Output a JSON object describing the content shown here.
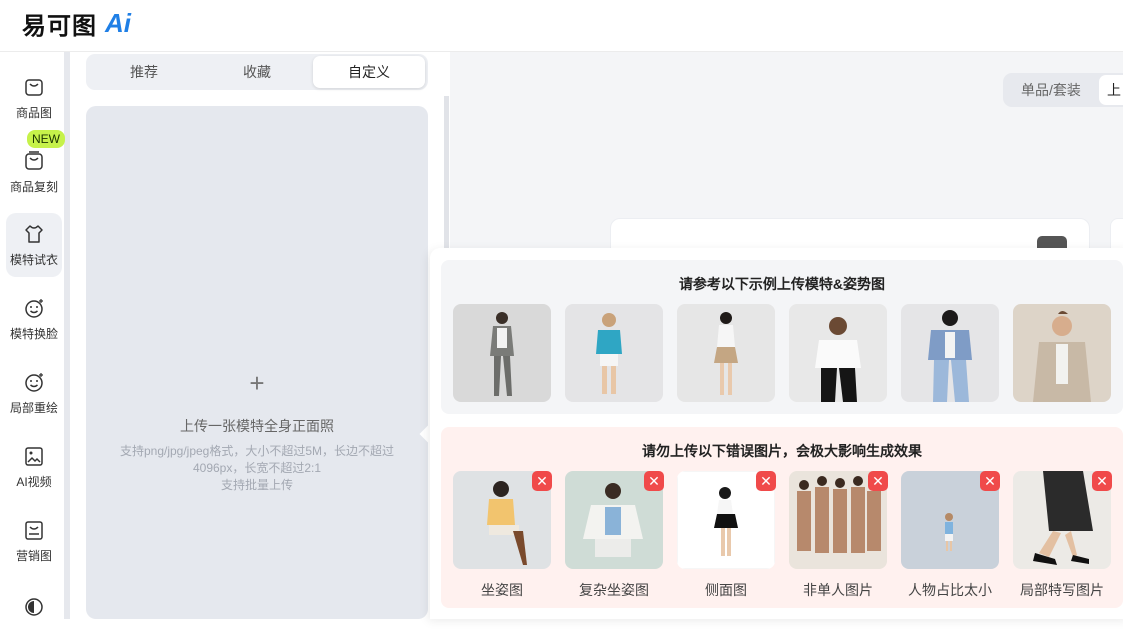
{
  "header": {
    "logo_text": "易可图",
    "logo_ai": "Ai"
  },
  "nav": {
    "new_badge": "NEW",
    "items": [
      {
        "label": "商品图",
        "icon": "bag-icon"
      },
      {
        "label": "商品复刻",
        "icon": "bag-copy-icon"
      },
      {
        "label": "模特试衣",
        "icon": "shirt-icon"
      },
      {
        "label": "模特换脸",
        "icon": "face-icon"
      },
      {
        "label": "局部重绘",
        "icon": "face-redraw-icon"
      },
      {
        "label": "AI视频",
        "icon": "video-icon"
      },
      {
        "label": "营销图",
        "icon": "marketing-icon"
      }
    ]
  },
  "tabs": [
    "推荐",
    "收藏",
    "自定义"
  ],
  "active_tab": "自定义",
  "upload": {
    "plus": "+",
    "title": "上传一张模特全身正面照",
    "desc_line1": "支持png/jpg/jpeg格式，大小不超过5M，长边不超过",
    "desc_line2": "4096px，长宽不超过2:1",
    "desc_line3": "支持批量上传"
  },
  "main": {
    "segment_left": "单品/套装",
    "segment_right": "上"
  },
  "popover": {
    "good_title": "请参考以下示例上传模特&姿势图",
    "bad_title": "请勿上传以下错误图片，会极大影响生成效果",
    "bad_captions": [
      "坐姿图",
      "复杂坐姿图",
      "侧面图",
      "非单人图片",
      "人物占比太小",
      "局部特写图片"
    ],
    "close_glyph": "✕"
  },
  "colors": {
    "accent": "#1f7fe6",
    "new_badge": "#c6f24a",
    "error": "#f04a4a"
  }
}
